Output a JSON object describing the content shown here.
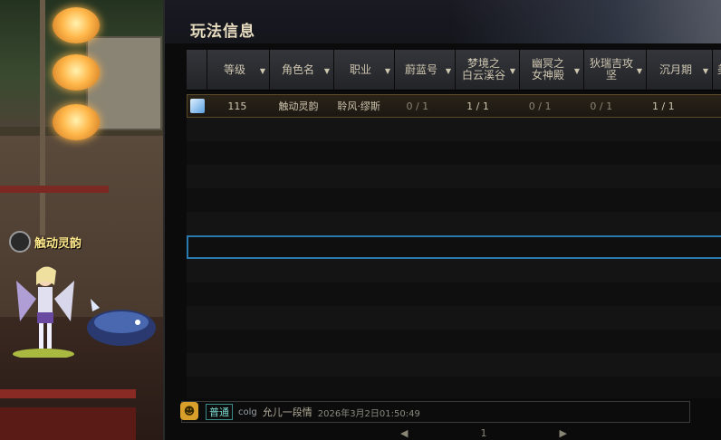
{
  "panel": {
    "title": "玩法信息"
  },
  "table": {
    "columns": [
      {
        "label": "",
        "sortable": false,
        "w": 22
      },
      {
        "label": "等级",
        "sortable": true
      },
      {
        "label": "角色名",
        "sortable": true
      },
      {
        "label": "职业",
        "sortable": true
      },
      {
        "label": "蔚蓝号",
        "sortable": true
      },
      {
        "label": "梦境之\n白云溪谷",
        "sortable": true
      },
      {
        "label": "幽冥之\n女神殿",
        "sortable": true
      },
      {
        "label": "狄瑞吉攻\n坚",
        "sortable": true
      },
      {
        "label": "沉月期",
        "sortable": true
      },
      {
        "label": "美",
        "sortable": false
      }
    ],
    "rows": [
      {
        "icon": "character-icon",
        "level": "115",
        "name": "触动灵韵",
        "job": "聆风·缪斯",
        "c1": "0 / 1",
        "c2": "1 / 1",
        "c3": "0 / 1",
        "c4": "0 / 1",
        "c5": "1 / 1"
      }
    ],
    "empty_rows": 12,
    "selected_row_index": 6
  },
  "scene": {
    "character_name": "触动灵韵"
  },
  "chat": {
    "channel": "普通",
    "user": "colg",
    "message": "允儿一段情",
    "time": "2026年3月2日01:50:49"
  },
  "pager": {
    "current": "1"
  },
  "colors": {
    "accent": "#2a7ab0",
    "header_text": "#cfc6b0",
    "name_text": "#ffe98a"
  }
}
